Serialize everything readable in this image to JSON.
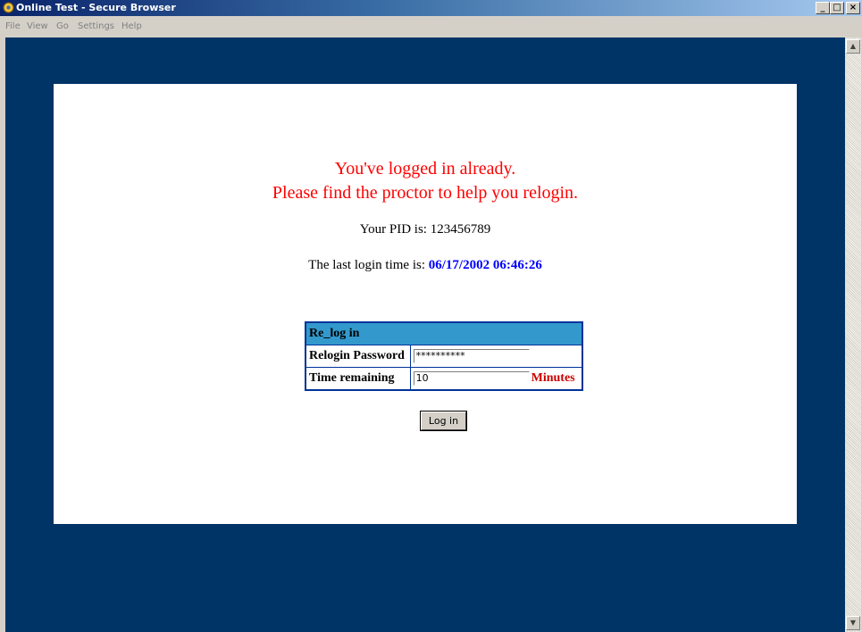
{
  "window": {
    "title": "Online Test - Secure Browser",
    "controls": [
      "_",
      "□",
      "×"
    ]
  },
  "menu": [
    "File",
    "View",
    "Go",
    "Settings",
    "Help"
  ],
  "message": {
    "line1": "You've logged in already.",
    "line2": "Please find the proctor to help you relogin."
  },
  "pid": {
    "label": "Your PID is: 123456789"
  },
  "last_login": {
    "label": "The last login time is:",
    "value": "06/17/2002 06:46:26"
  },
  "relogin": {
    "header": "Re_log in",
    "password_label": "Relogin Password",
    "password_value": "**********",
    "time_label": "Time remaining",
    "time_value": "10",
    "time_unit": "Minutes"
  },
  "login_button": "Log in",
  "colors": {
    "background": "#003366",
    "message": "#ff0000",
    "time": "#0000ff",
    "table_header": "#3399cc",
    "table_border": "#003399"
  }
}
